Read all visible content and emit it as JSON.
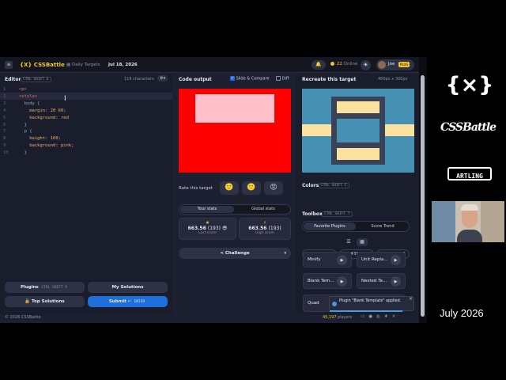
{
  "header": {
    "logo": "{X} CSSBattle",
    "daily_targets": "Daily Targets",
    "date": "Jul 18, 2026",
    "online_count": "22",
    "online_label": "Online",
    "user": "Joe",
    "user_badge": "PLUS"
  },
  "editor": {
    "title": "Editor",
    "shortcut": "CTRL SHIFT E",
    "char_count": "116 characters",
    "lines": [
      {
        "n": "1",
        "text": "<p>"
      },
      {
        "n": "2",
        "text": "<style>"
      },
      {
        "n": "3",
        "text": "  body {"
      },
      {
        "n": "4",
        "text": "    margin: 20 60;"
      },
      {
        "n": "5",
        "text": "    background: red"
      },
      {
        "n": "6",
        "text": "  }"
      },
      {
        "n": "7",
        "text": "  p {"
      },
      {
        "n": "8",
        "text": "    height: 100;"
      },
      {
        "n": "9",
        "text": "    background: pink;"
      },
      {
        "n": "10",
        "text": "  }"
      }
    ],
    "plugins_label": "Plugins",
    "plugins_shortcut": "CTRL SHIFT P",
    "my_solutions_label": "My Solutions",
    "top_solutions_label": "Top Solutions",
    "submit_label": "Submit",
    "submit_shortcut": "ENTER"
  },
  "output": {
    "title": "Code output",
    "slide_compare": "Slide & Compare",
    "diff": "Diff",
    "rate_label": "Rate this target",
    "tab_your_stats": "Your stats",
    "tab_global_stats": "Global stats",
    "last_score": "663.56",
    "last_score_chars": "(193)",
    "last_score_label": "Last score",
    "high_score": "663.56",
    "high_score_chars": "(193)",
    "high_score_label": "High score",
    "challenge_label": "Challenge"
  },
  "target": {
    "title": "Recreate this target",
    "size": "400px x 300px",
    "colors_label": "Colors",
    "colors_shortcut": "CTRL SHIFT C",
    "colors": [
      {
        "hex": "#4690B4",
        "value": "#4690B4"
      },
      {
        "hex": "#394257",
        "value": "#394257"
      },
      {
        "hex": "#FAE29E",
        "value": "#FAE29E"
      }
    ],
    "toolbox_label": "Toolbox",
    "toolbox_shortcut": "CTRL SHIFT T",
    "tab_favorite_plugins": "Favorite Plugins",
    "tab_score_trend": "Score Trend",
    "tools": [
      "Minify",
      "Unit Repla...",
      "Blank Tem...",
      "Nested Te...",
      "Quad"
    ],
    "toast_text": "Plugin \"Blank Template\" applied."
  },
  "footer": {
    "copyright": "© 2026 CSSBattle",
    "players_count": "45,197",
    "players_label": "players"
  },
  "side": {
    "brand_symbol": "{×}",
    "brand_name": "CSSBattle",
    "artling": "ARTLING",
    "date_caption": "July 2026"
  },
  "colors": {
    "accent_yellow": "#f4c430",
    "submit_blue": "#1e6fd9",
    "output_red": "#ff0000",
    "output_pink": "#ffc0cb"
  }
}
